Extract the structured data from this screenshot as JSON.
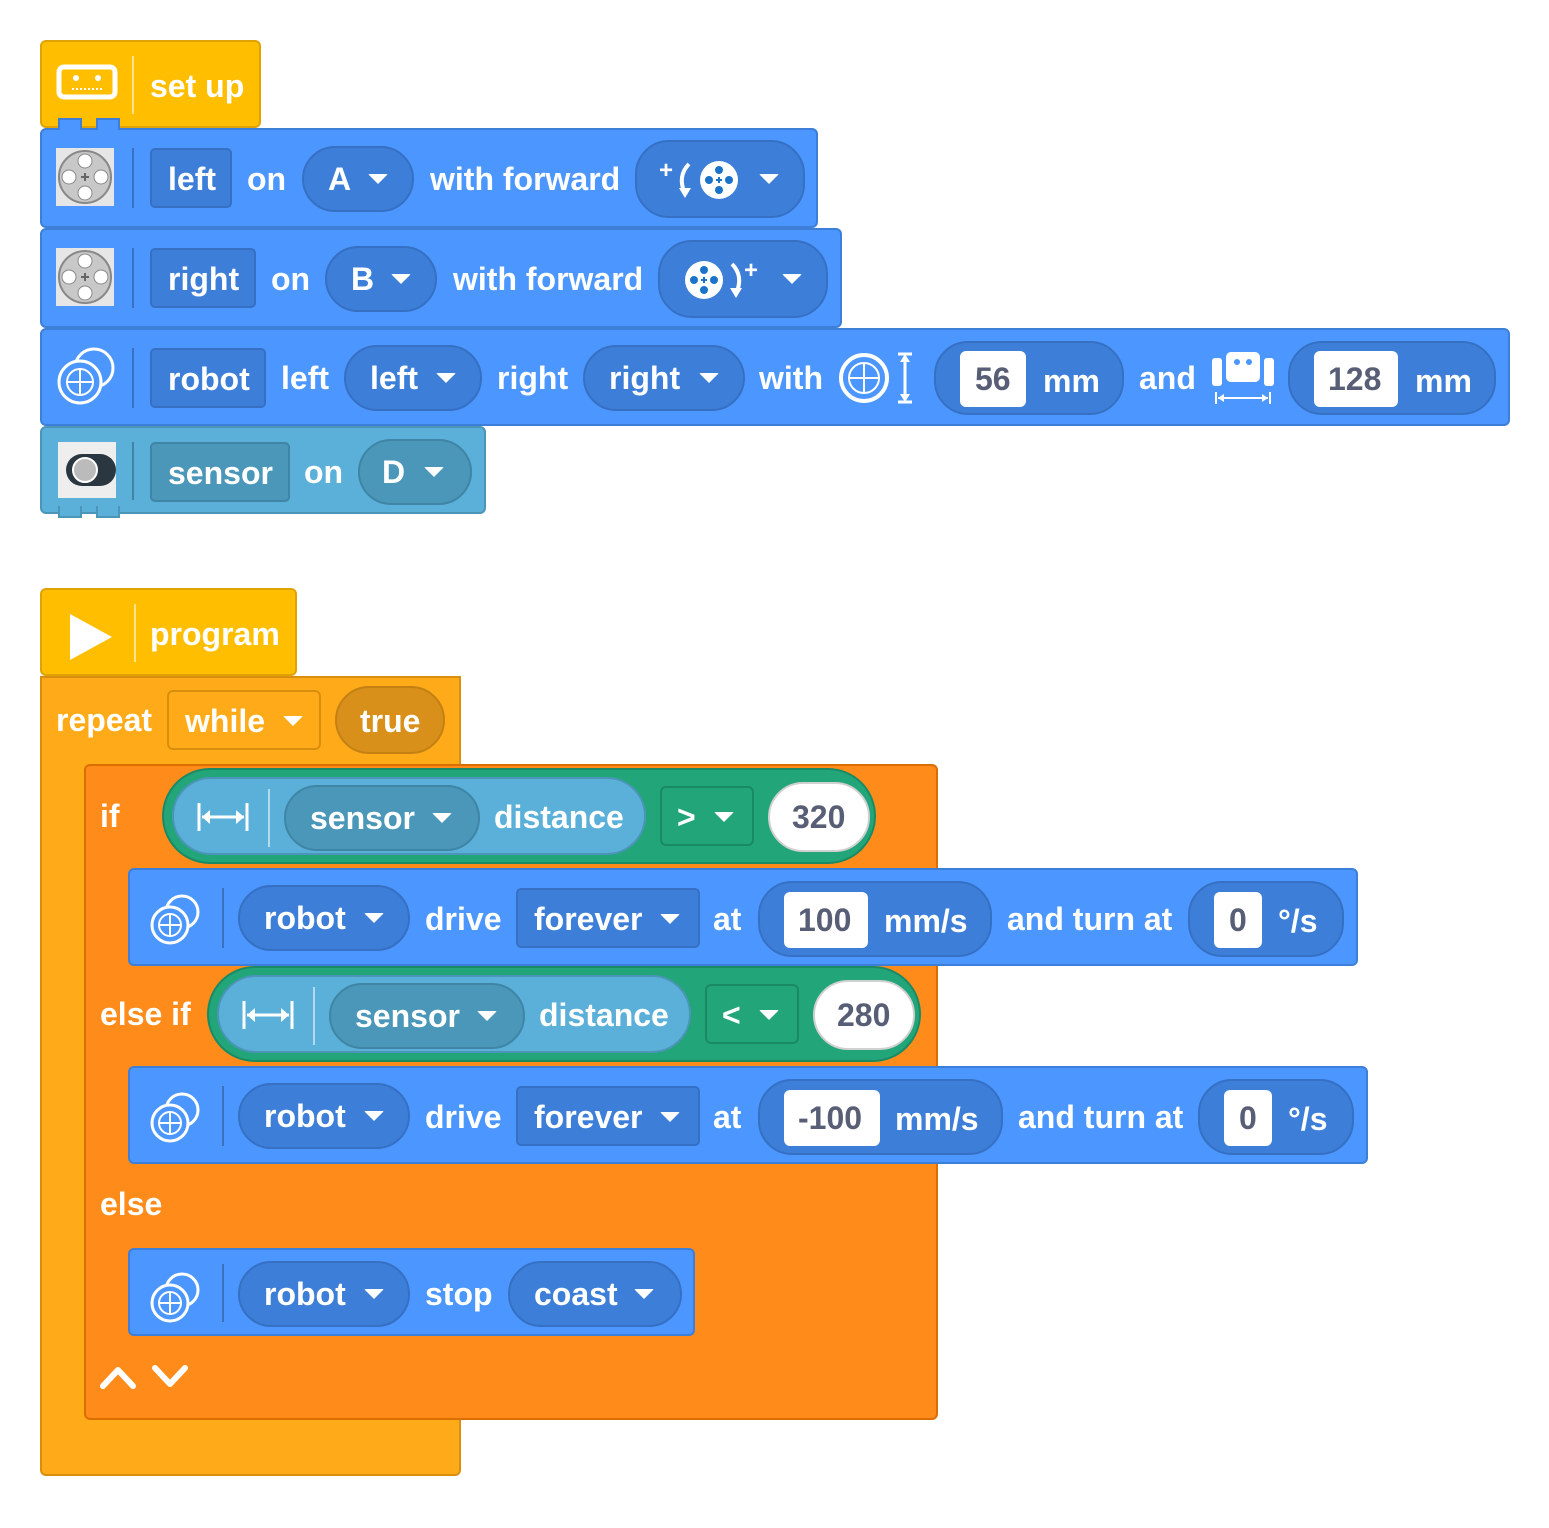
{
  "setup": {
    "hat_label": "set up",
    "left_motor": {
      "name": "left",
      "on": "on",
      "port": "A",
      "with_forward": "with forward"
    },
    "right_motor": {
      "name": "right",
      "on": "on",
      "port": "B",
      "with_forward": "with forward"
    },
    "robot": {
      "name": "robot",
      "left_label": "left",
      "left_value": "left",
      "right_label": "right",
      "right_value": "right",
      "with": "with",
      "wheel_diameter": "56",
      "unit1": "mm",
      "and": "and",
      "axle_track": "128",
      "unit2": "mm"
    },
    "sensor": {
      "name": "sensor",
      "on": "on",
      "port": "D"
    }
  },
  "program": {
    "hat_label": "program",
    "repeat": {
      "label": "repeat",
      "mode": "while",
      "condition": "true"
    },
    "if_block": {
      "if_label": "if",
      "cond1": {
        "sensor": "sensor",
        "measure": "distance",
        "op": ">",
        "value": "320"
      },
      "drive1": {
        "robot": "robot",
        "action": "drive",
        "duration": "forever",
        "at": "at",
        "speed": "100",
        "speed_unit": "mm/s",
        "turn_label": "and turn at",
        "turn": "0",
        "turn_unit": "°/s"
      },
      "elseif_label": "else if",
      "cond2": {
        "sensor": "sensor",
        "measure": "distance",
        "op": "<",
        "value": "280"
      },
      "drive2": {
        "robot": "robot",
        "action": "drive",
        "duration": "forever",
        "at": "at",
        "speed": "-100",
        "speed_unit": "mm/s",
        "turn_label": "and turn at",
        "turn": "0",
        "turn_unit": "°/s"
      },
      "else_label": "else",
      "stop": {
        "robot": "robot",
        "action": "stop",
        "mode": "coast"
      }
    }
  },
  "colors": {
    "hat": "#ffbf00",
    "motion": "#4c97ff",
    "sensor": "#5ab0d8",
    "control": "#ff8c1a",
    "loop": "#ffab19",
    "operator": "#22a579"
  }
}
